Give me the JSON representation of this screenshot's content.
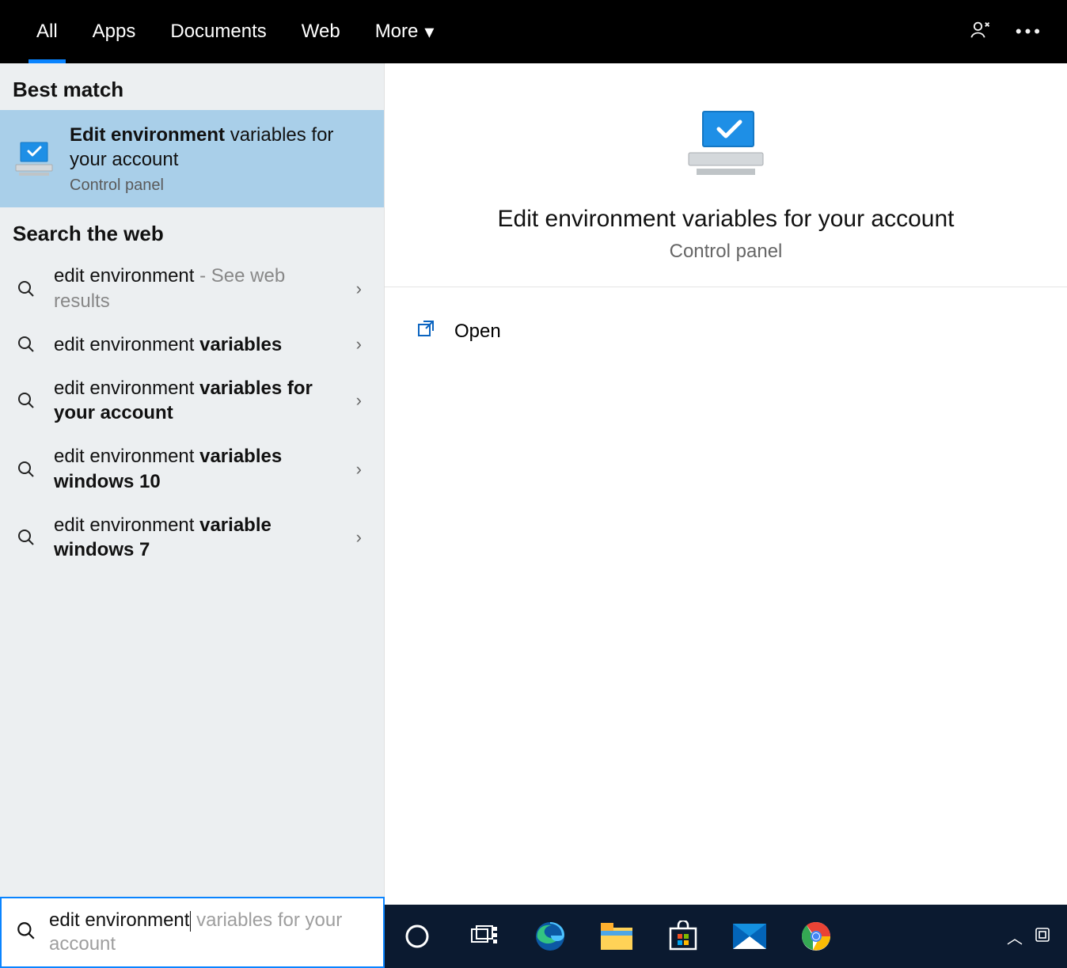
{
  "tabs": {
    "all": "All",
    "apps": "Apps",
    "documents": "Documents",
    "web": "Web",
    "more": "More"
  },
  "sections": {
    "best_match": "Best match",
    "search_web": "Search the web"
  },
  "best_match": {
    "title_bold": "Edit environment",
    "title_rest": " variables for your account",
    "subtitle": "Control panel"
  },
  "web_results": [
    {
      "prefix": "edit environment",
      "bold": "",
      "suffix": " - See web results",
      "suffix_muted": true
    },
    {
      "prefix": "edit environment ",
      "bold": "variables",
      "suffix": ""
    },
    {
      "prefix": "edit environment ",
      "bold": "variables for your account",
      "suffix": ""
    },
    {
      "prefix": "edit environment ",
      "bold": "variables windows 10",
      "suffix": ""
    },
    {
      "prefix": "edit environment ",
      "bold": "variable windows 7",
      "suffix": ""
    }
  ],
  "detail": {
    "title": "Edit environment variables for your account",
    "subtitle": "Control panel",
    "open": "Open"
  },
  "search": {
    "typed": "edit environment",
    "ghost_rest": " variables for your account"
  }
}
